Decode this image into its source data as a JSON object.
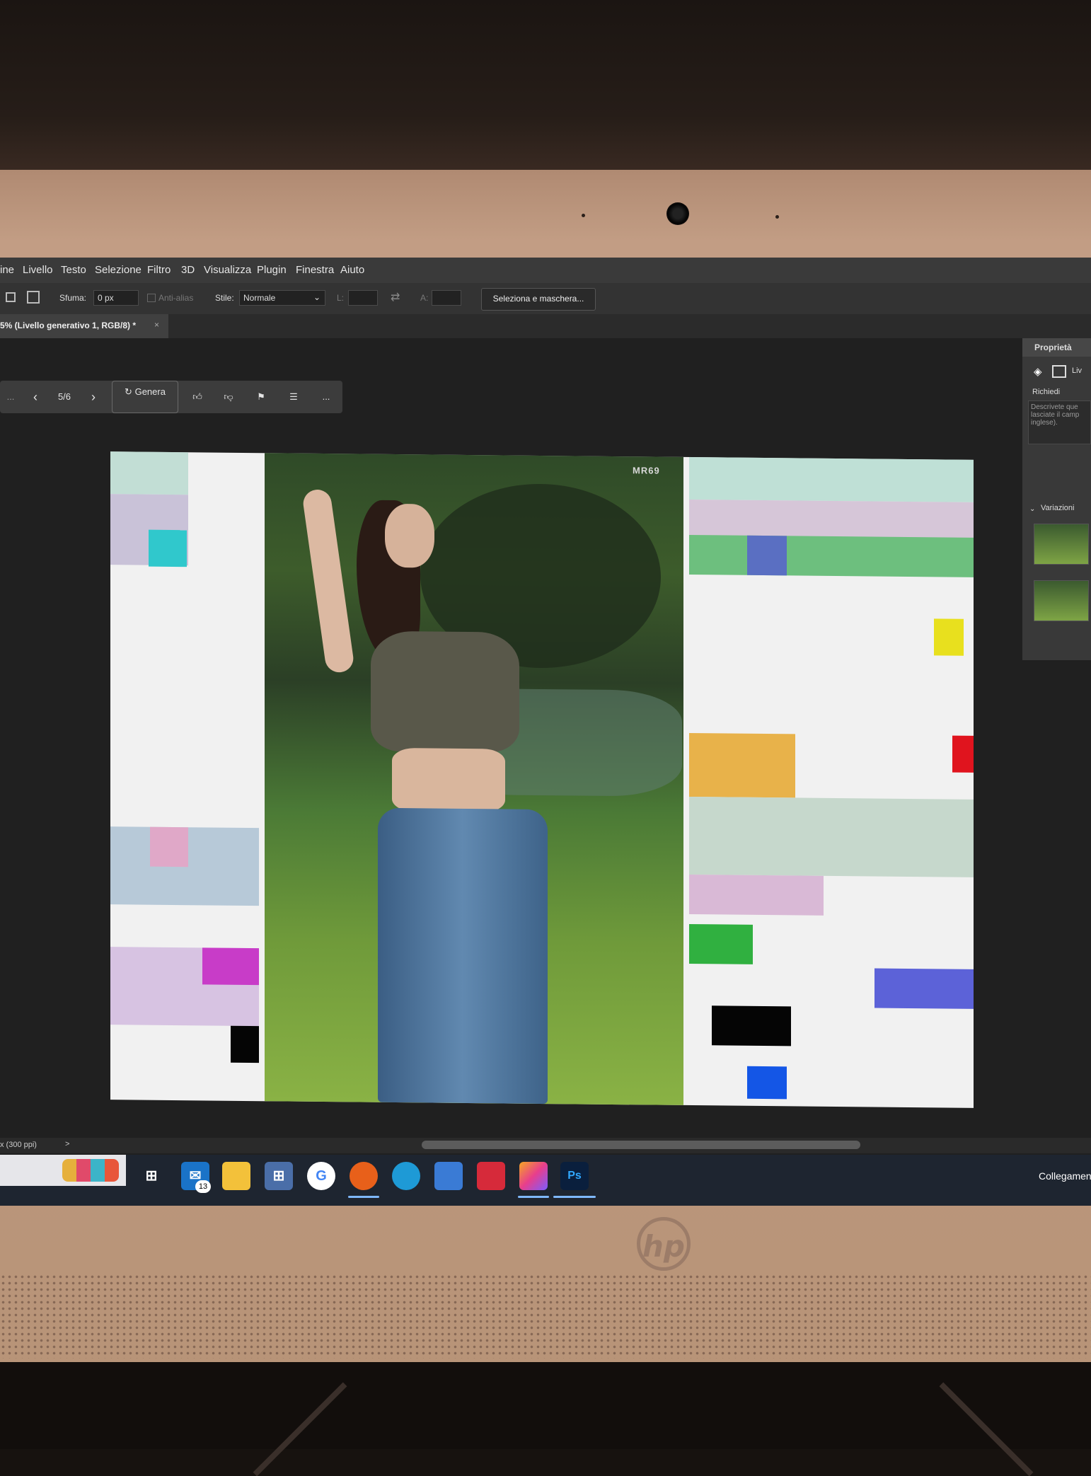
{
  "menu": {
    "items": [
      "ine",
      "Livello",
      "Testo",
      "Selezione",
      "Filtro",
      "3D",
      "Visualizza",
      "Plugin",
      "Finestra",
      "Aiuto"
    ]
  },
  "options_bar": {
    "feather_label": "Sfuma:",
    "feather_value": "0 px",
    "antialias_label": "Anti-alias",
    "style_label": "Stile:",
    "style_value": "Normale",
    "width_label": "L:",
    "height_label": "A:",
    "select_mask_button": "Seleziona e maschera..."
  },
  "document_tab": {
    "title": "5% (Livello generativo 1, RGB/8) *",
    "close": "×"
  },
  "contextual_taskbar": {
    "truncated_label": "...",
    "variation_counter": "5/6",
    "generate_label": "Genera",
    "more": "..."
  },
  "canvas": {
    "watermark": "MR69"
  },
  "properties_panel": {
    "title": "Proprietà",
    "layer_label": "Liv",
    "prompt_label": "Richiedi",
    "prompt_placeholder": "Descrivete que lasciate il camp inglese).",
    "variations_label": "Variazioni"
  },
  "status_bar": {
    "resolution": "x (300 ppi)",
    "arrow": ">"
  },
  "taskbar": {
    "mail_badge": "13",
    "photoshop_label": "Ps",
    "tray_text": "Collegamen"
  },
  "brand": {
    "logo": "hp"
  },
  "colors": {
    "ps_menubar": "#3a3a3a",
    "ps_canvas_bg": "#202020",
    "taskbar": "#1e2530",
    "bezel": "#c29d84"
  }
}
